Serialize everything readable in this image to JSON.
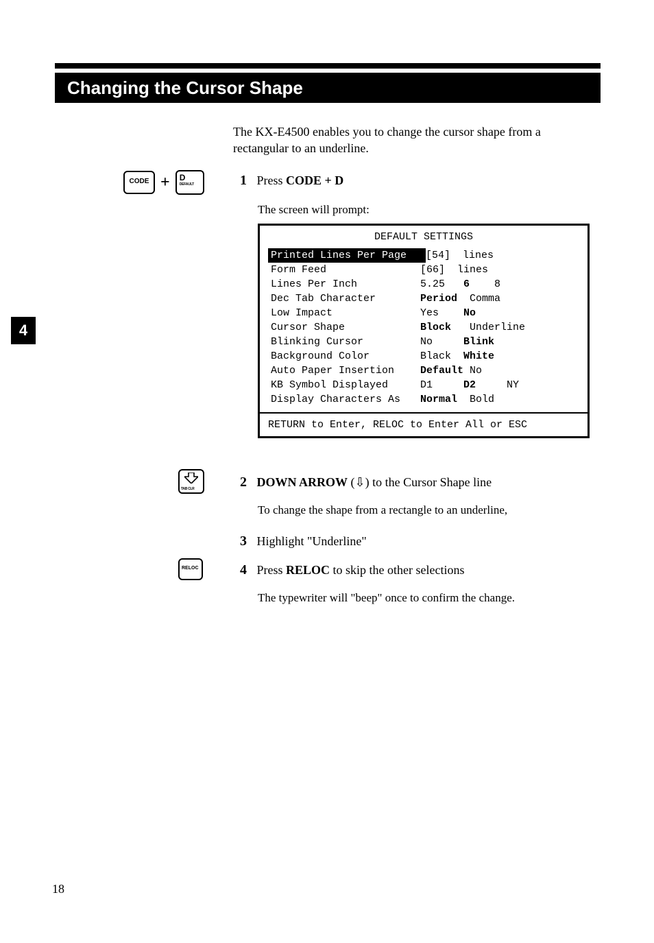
{
  "section_title": "Changing the Cursor Shape",
  "intro": "The KX-E4500 enables you to change the cursor shape from a rectangular to an underline.",
  "keys": {
    "code_label": "CODE",
    "d_label": "D",
    "d_sub": "DEFAULT",
    "plus": "+",
    "arrow_sub": "TAB CLR",
    "reloc_label": "RELOC"
  },
  "steps": {
    "s1_num": "1",
    "s1_prefix": "Press ",
    "s1_bold": "CODE + D",
    "s1_prompt": "The screen will prompt:",
    "s2_num": "2",
    "s2_bold": "DOWN ARROW",
    "s2_rest": " (⇩) to the Cursor Shape line",
    "s2_sub": "To change the shape from a rectangle to an underline,",
    "s3_num": "3",
    "s3_text": "Highlight \"Underline\"",
    "s4_num": "4",
    "s4_prefix": "Press ",
    "s4_bold": "RELOC",
    "s4_rest": " to skip the other selections",
    "s4_sub": "The typewriter will \"beep\" once to confirm the change."
  },
  "settings": {
    "title": "DEFAULT SETTINGS",
    "rows": [
      {
        "label": "Printed Lines Per Page",
        "selected": true,
        "opts": [
          {
            "t": "[54]  lines",
            "b": false
          }
        ]
      },
      {
        "label": "Form Feed",
        "selected": false,
        "opts": [
          {
            "t": "[66]  lines",
            "b": false
          }
        ]
      },
      {
        "label": "Lines Per Inch",
        "selected": false,
        "opts": [
          {
            "t": "5.25   ",
            "b": false
          },
          {
            "t": "6",
            "b": true
          },
          {
            "t": "    8",
            "b": false
          }
        ]
      },
      {
        "label": "Dec Tab Character",
        "selected": false,
        "opts": [
          {
            "t": "Period",
            "b": true
          },
          {
            "t": "  Comma",
            "b": false
          }
        ]
      },
      {
        "label": "Low Impact",
        "selected": false,
        "opts": [
          {
            "t": "Yes    ",
            "b": false
          },
          {
            "t": "No",
            "b": true
          }
        ]
      },
      {
        "label": "Cursor Shape",
        "selected": false,
        "opts": [
          {
            "t": "Block",
            "b": true
          },
          {
            "t": "   Underline",
            "b": false
          }
        ]
      },
      {
        "label": "Blinking Cursor",
        "selected": false,
        "opts": [
          {
            "t": "No     ",
            "b": false
          },
          {
            "t": "Blink",
            "b": true
          }
        ]
      },
      {
        "label": "Background Color",
        "selected": false,
        "opts": [
          {
            "t": "Black  ",
            "b": false
          },
          {
            "t": "White",
            "b": true
          }
        ]
      },
      {
        "label": "Auto Paper Insertion",
        "selected": false,
        "opts": [
          {
            "t": "Default",
            "b": true
          },
          {
            "t": " No",
            "b": false
          }
        ]
      },
      {
        "label": "KB Symbol Displayed",
        "selected": false,
        "opts": [
          {
            "t": "D1     ",
            "b": false
          },
          {
            "t": "D2",
            "b": true
          },
          {
            "t": "     NY",
            "b": false
          }
        ]
      },
      {
        "label": "Display Characters As",
        "selected": false,
        "opts": [
          {
            "t": "Normal",
            "b": true
          },
          {
            "t": "  Bold",
            "b": false
          }
        ]
      }
    ],
    "footer": "RETURN to Enter, RELOC to Enter All or ESC"
  },
  "side_tab": "4",
  "page_number": "18"
}
